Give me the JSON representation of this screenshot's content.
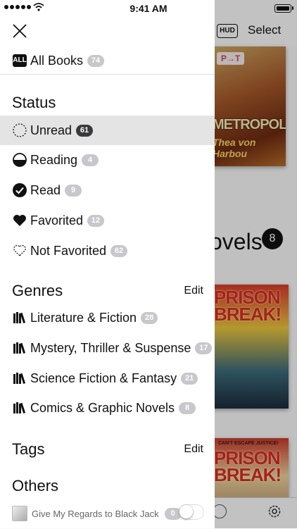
{
  "status_bar": {
    "time": "9:41 AM"
  },
  "background": {
    "hud_label": "HUD",
    "select_label": "Select",
    "metropolis_badge": "P→T",
    "metropolis_title": "METROPOLIS",
    "metropolis_author": "Thea von Harbou",
    "section_title_visible": "ovels",
    "section_count": "8",
    "prison_title": "PRISON BREAK!",
    "prison2_tagline": "CAN'T ESCAPE JUSTICE!",
    "prison2_title": "PRISON BREAK!"
  },
  "drawer": {
    "all_books": {
      "icon_label": "ALL",
      "label": "All Books",
      "count": "74"
    },
    "status": {
      "header": "Status",
      "items": [
        {
          "label": "Unread",
          "count": "61",
          "icon": "dashed-circle-icon"
        },
        {
          "label": "Reading",
          "count": "4",
          "icon": "half-circle-icon"
        },
        {
          "label": "Read",
          "count": "9",
          "icon": "check-circle-icon"
        },
        {
          "label": "Favorited",
          "count": "12",
          "icon": "heart-icon"
        },
        {
          "label": "Not Favorited",
          "count": "62",
          "icon": "dashed-heart-icon"
        }
      ]
    },
    "genres": {
      "header": "Genres",
      "edit_label": "Edit",
      "items": [
        {
          "label": "Literature & Fiction",
          "count": "28",
          "icon": "books-icon"
        },
        {
          "label": "Mystery, Thriller & Suspense",
          "count": "17",
          "icon": "books-icon"
        },
        {
          "label": "Science Fiction & Fantasy",
          "count": "21",
          "icon": "books-icon"
        },
        {
          "label": "Comics & Graphic Novels",
          "count": "8",
          "icon": "books-icon"
        }
      ]
    },
    "tags": {
      "header": "Tags",
      "edit_label": "Edit"
    },
    "others": {
      "header": "Others",
      "item": {
        "label": "Give My Regards to Black Jack",
        "count": "0"
      }
    }
  }
}
